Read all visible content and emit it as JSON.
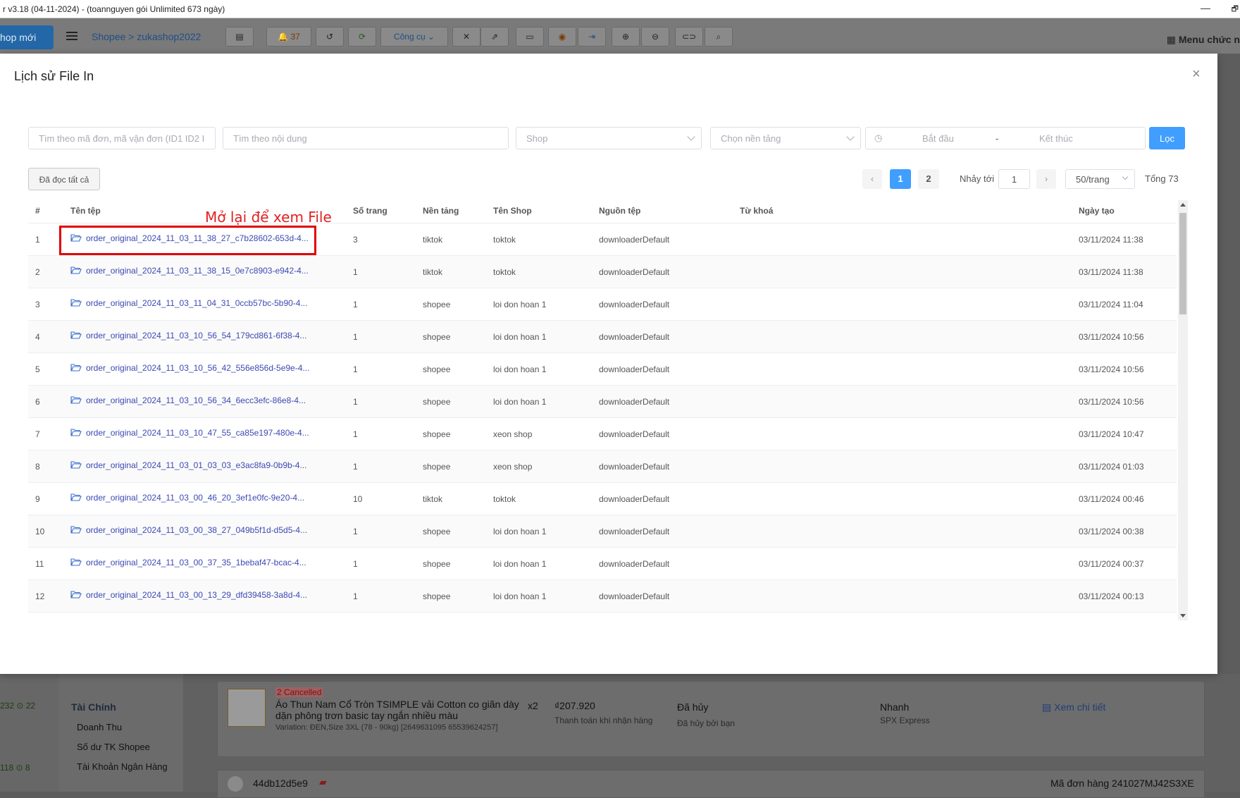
{
  "window": {
    "title": "r v3.18 (04-11-2024) - (toannguyen gói Unlimited 673 ngày)",
    "min": "—",
    "max": "🗗"
  },
  "toolbar": {
    "shop_button": "hop mới",
    "breadcrumb": "Shopee > zukashop2022",
    "notif_count": "37",
    "tools_label": "Công cụ",
    "menu_label": "Menu chức n"
  },
  "modal": {
    "title": "Lịch sử File In",
    "close": "×",
    "search_order_placeholder": "Tìm theo mã đơn, mã vận đơn (ID1 ID2 I",
    "search_content_placeholder": "Tìm theo nội dung",
    "shop_placeholder": "Shop",
    "platform_placeholder": "Chọn nền tảng",
    "date_start": "Bắt đầu",
    "date_sep": "-",
    "date_end": "Kết thúc",
    "filter_button": "Lọc",
    "mark_read_button": "Đã đọc tất cả",
    "pagination": {
      "prev": "‹",
      "pages": [
        "1",
        "2"
      ],
      "active": "1",
      "next": "›",
      "jump_label": "Nhảy tới",
      "jump_value": "1",
      "per_page": "50/trang",
      "total": "Tổng 73"
    },
    "annotation": "Mở lại để xem File",
    "columns": {
      "index": "#",
      "file": "Tên tệp",
      "pages": "Số trang",
      "platform": "Nền tảng",
      "shop": "Tên Shop",
      "source": "Nguồn tệp",
      "keyword": "Từ khoá",
      "date": "Ngày tạo"
    },
    "rows": [
      {
        "i": "1",
        "file": "order_original_2024_11_03_11_38_27_c7b28602-653d-4...",
        "pages": "3",
        "platform": "tiktok",
        "shop": "toktok",
        "source": "downloaderDefault",
        "date": "03/11/2024 11:38"
      },
      {
        "i": "2",
        "file": "order_original_2024_11_03_11_38_15_0e7c8903-e942-4...",
        "pages": "1",
        "platform": "tiktok",
        "shop": "toktok",
        "source": "downloaderDefault",
        "date": "03/11/2024 11:38"
      },
      {
        "i": "3",
        "file": "order_original_2024_11_03_11_04_31_0ccb57bc-5b90-4...",
        "pages": "1",
        "platform": "shopee",
        "shop": "loi don hoan 1",
        "source": "downloaderDefault",
        "date": "03/11/2024 11:04"
      },
      {
        "i": "4",
        "file": "order_original_2024_11_03_10_56_54_179cd861-6f38-4...",
        "pages": "1",
        "platform": "shopee",
        "shop": "loi don hoan 1",
        "source": "downloaderDefault",
        "date": "03/11/2024 10:56"
      },
      {
        "i": "5",
        "file": "order_original_2024_11_03_10_56_42_556e856d-5e9e-4...",
        "pages": "1",
        "platform": "shopee",
        "shop": "loi don hoan 1",
        "source": "downloaderDefault",
        "date": "03/11/2024 10:56"
      },
      {
        "i": "6",
        "file": "order_original_2024_11_03_10_56_34_6ecc3efc-86e8-4...",
        "pages": "1",
        "platform": "shopee",
        "shop": "loi don hoan 1",
        "source": "downloaderDefault",
        "date": "03/11/2024 10:56"
      },
      {
        "i": "7",
        "file": "order_original_2024_11_03_10_47_55_ca85e197-480e-4...",
        "pages": "1",
        "platform": "shopee",
        "shop": "xeon shop",
        "source": "downloaderDefault",
        "date": "03/11/2024 10:47"
      },
      {
        "i": "8",
        "file": "order_original_2024_11_03_01_03_03_e3ac8fa9-0b9b-4...",
        "pages": "1",
        "platform": "shopee",
        "shop": "xeon shop",
        "source": "downloaderDefault",
        "date": "03/11/2024 01:03"
      },
      {
        "i": "9",
        "file": "order_original_2024_11_03_00_46_20_3ef1e0fc-9e20-4...",
        "pages": "10",
        "platform": "tiktok",
        "shop": "toktok",
        "source": "downloaderDefault",
        "date": "03/11/2024 00:46"
      },
      {
        "i": "10",
        "file": "order_original_2024_11_03_00_38_27_049b5f1d-d5d5-4...",
        "pages": "1",
        "platform": "shopee",
        "shop": "loi don hoan 1",
        "source": "downloaderDefault",
        "date": "03/11/2024 00:38"
      },
      {
        "i": "11",
        "file": "order_original_2024_11_03_00_37_35_1bebaf47-bcac-4...",
        "pages": "1",
        "platform": "shopee",
        "shop": "loi don hoan 1",
        "source": "downloaderDefault",
        "date": "03/11/2024 00:37"
      },
      {
        "i": "12",
        "file": "order_original_2024_11_03_00_13_29_dfd39458-3a8d-4...",
        "pages": "1",
        "platform": "shopee",
        "shop": "loi don hoan 1",
        "source": "downloaderDefault",
        "date": "03/11/2024 00:13"
      }
    ]
  },
  "background": {
    "sidebar_heading": "Tài Chính",
    "sidebar_items": [
      "Doanh Thu",
      "Số dư TK Shopee",
      "Tài Khoản Ngân Hàng"
    ],
    "left_stats": [
      "232 ⊙ 22",
      "118 ⊙ 8"
    ],
    "order1": {
      "status_badge": "2 Cancelled",
      "product": "Áo Thun Nam Cổ Tròn TSIMPLE vải Cotton co giãn dày dặn phông trơn basic tay ngắn nhiều màu",
      "variation": "Variation: ĐEN,Size 3XL (78 - 90kg) [2649631095 65539624257]",
      "qty": "x2",
      "price": "₫207.920",
      "payment": "Thanh toán khi nhận hàng",
      "status": "Đã hủy",
      "status_sub": "Đã hủy bởi bạn",
      "shipping": "Nhanh",
      "carrier": "SPX Express",
      "detail_link": "Xem chi tiết"
    },
    "order2": {
      "user": "44db12d5e9",
      "order_code": "Mã đơn hàng 241027MJ42S3XE"
    }
  }
}
